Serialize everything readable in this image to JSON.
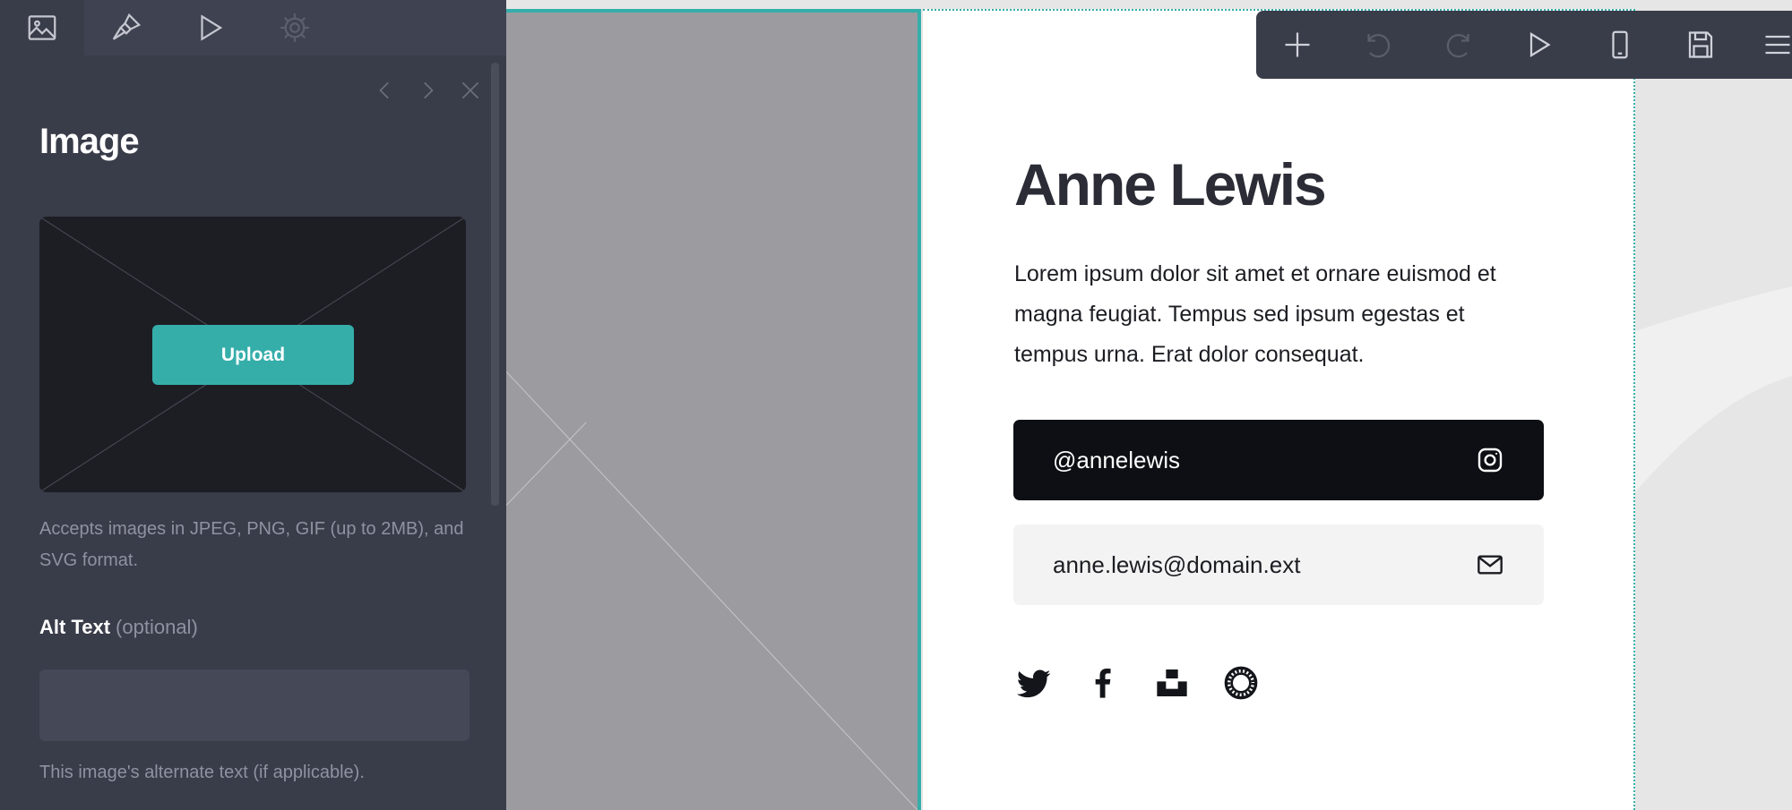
{
  "panel": {
    "tabs": [
      {
        "icon": "image-icon",
        "active": true
      },
      {
        "icon": "brush-icon",
        "active": false
      },
      {
        "icon": "play-icon",
        "active": false
      },
      {
        "icon": "gear-icon",
        "active": false
      }
    ],
    "title": "Image",
    "upload_label": "Upload",
    "image_help": "Accepts images in JPEG, PNG, GIF (up to 2MB), and SVG format.",
    "alt_label": "Alt Text",
    "alt_optional": "(optional)",
    "alt_value": "",
    "alt_help": "This image's alternate text (if applicable)."
  },
  "page": {
    "name": "Anne Lewis",
    "bio": "Lorem ipsum dolor sit amet et ornare euismod et magna feugiat. Tempus sed ipsum egestas et tempus urna. Erat dolor consequat.",
    "instagram": "@annelewis",
    "email": "anne.lewis@domain.ext",
    "socials": [
      "twitter-icon",
      "facebook-icon",
      "unsplash-icon",
      "circle-ring-icon"
    ]
  },
  "toolbar": {
    "items": [
      "add-icon",
      "undo-icon",
      "redo-icon",
      "preview-icon",
      "mobile-icon",
      "save-icon",
      "menu-icon"
    ]
  },
  "colors": {
    "accent": "#35aeaa",
    "panel_bg": "#393c49",
    "dark_button": "#0e0f14"
  }
}
